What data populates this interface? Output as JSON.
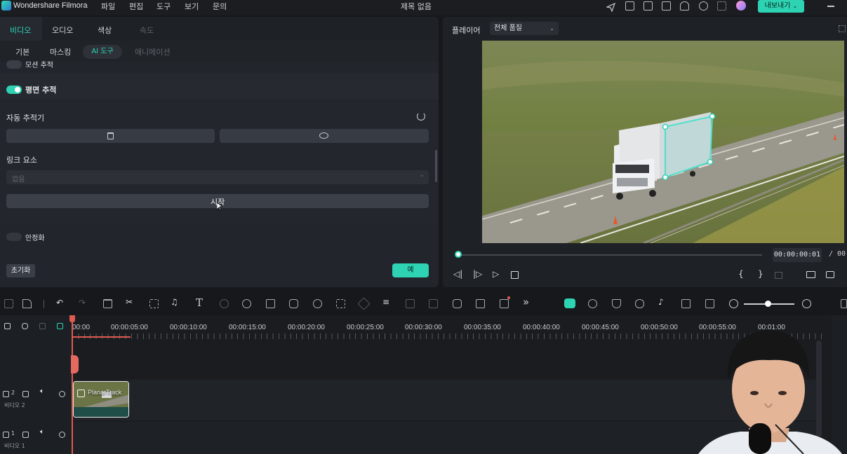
{
  "app": {
    "name": "Wondershare Filmora",
    "title": "제목 없음"
  },
  "menu": [
    "파일",
    "편집",
    "도구",
    "보기",
    "문의"
  ],
  "topbar": {
    "export_label": "내보내기"
  },
  "panel": {
    "tabs": [
      "비디오",
      "오디오",
      "색상",
      "속도"
    ],
    "subtabs": [
      "기본",
      "마스킹",
      "AI 도구",
      "애니메이션"
    ],
    "motion_tracking_label": "모션 추적",
    "planar_tracking_label": "평면 추적",
    "auto_tracker_label": "자동 추적기",
    "link_element_label": "링크 요소",
    "link_element_value": "없음",
    "start_label": "시작",
    "stabilize_label": "안정화",
    "reset_label": "초기화",
    "ok_label": "예"
  },
  "player": {
    "label": "플레이어",
    "quality": "전체 품질",
    "timecode": "00:00:00:01",
    "timecode_total": "/ 00:"
  },
  "timeline": {
    "ruler": [
      "00:00",
      "00:00:05:00",
      "00:00:10:00",
      "00:00:15:00",
      "00:00:20:00",
      "00:00:25:00",
      "00:00:30:00",
      "00:00:35:00",
      "00:00:40:00",
      "00:00:45:00",
      "00:00:50:00",
      "00:00:55:00",
      "00:01:00"
    ],
    "tracks": [
      {
        "num": "2",
        "name": "비디오 2"
      },
      {
        "num": "1",
        "name": "비디오 1"
      }
    ],
    "clip_name": "PlanarTrack"
  }
}
